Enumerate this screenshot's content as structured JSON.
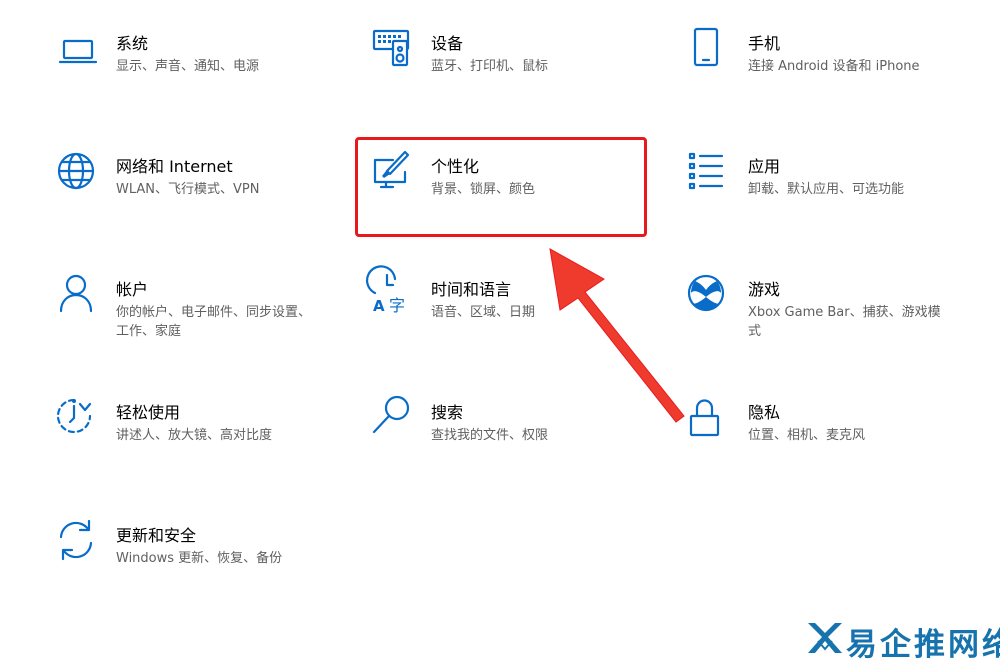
{
  "accent_color": "#0a6cc9",
  "highlight_color": "#e8191e",
  "tiles": [
    {
      "title": "系统",
      "desc": "显示、声音、通知、电源",
      "icon": "laptop-icon"
    },
    {
      "title": "设备",
      "desc": "蓝牙、打印机、鼠标",
      "icon": "keyboard-speaker-icon"
    },
    {
      "title": "手机",
      "desc": "连接 Android 设备和 iPhone",
      "icon": "phone-icon"
    },
    {
      "title": "网络和 Internet",
      "desc": "WLAN、飞行模式、VPN",
      "icon": "globe-icon"
    },
    {
      "title": "个性化",
      "desc": "背景、锁屏、颜色",
      "icon": "paint-monitor-icon"
    },
    {
      "title": "应用",
      "desc": "卸载、默认应用、可选功能",
      "icon": "list-icon"
    },
    {
      "title": "帐户",
      "desc": "你的帐户、电子邮件、同步设置、工作、家庭",
      "icon": "person-icon"
    },
    {
      "title": "时间和语言",
      "desc": "语音、区域、日期",
      "icon": "time-language-icon"
    },
    {
      "title": "游戏",
      "desc": "Xbox Game Bar、捕获、游戏模式",
      "icon": "xbox-icon"
    },
    {
      "title": "轻松使用",
      "desc": "讲述人、放大镜、高对比度",
      "icon": "ease-of-access-icon"
    },
    {
      "title": "搜索",
      "desc": "查找我的文件、权限",
      "icon": "search-icon"
    },
    {
      "title": "隐私",
      "desc": "位置、相机、麦克风",
      "icon": "lock-icon"
    },
    {
      "title": "更新和安全",
      "desc": "Windows 更新、恢复、备份",
      "icon": "sync-icon"
    }
  ],
  "watermark": {
    "text": "易企推网络",
    "icon": "logo-icon"
  }
}
